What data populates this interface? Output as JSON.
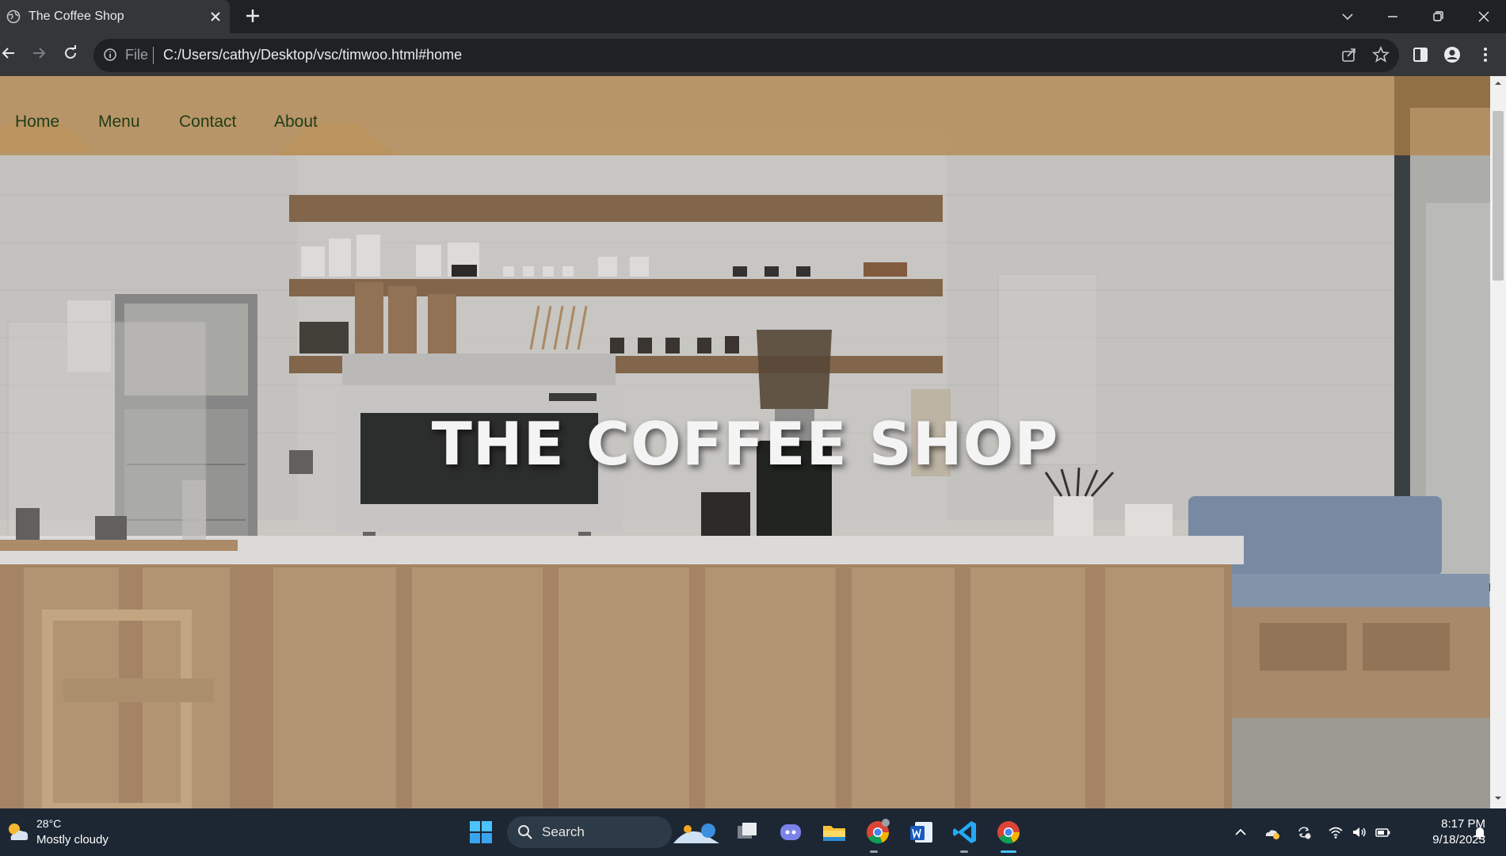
{
  "browser": {
    "tab_title": "The Coffee Shop",
    "omnibox": {
      "scheme_label": "File",
      "url": "C:/Users/cathy/Desktop/vsc/timwoo.html#home"
    }
  },
  "page": {
    "nav": [
      {
        "label": "Home"
      },
      {
        "label": "Menu"
      },
      {
        "label": "Contact"
      },
      {
        "label": "About"
      }
    ],
    "hero_title": "THE COFFEE SHOP",
    "colors": {
      "nav_bar": "#b48446",
      "nav_text": "#1f3d18",
      "hero_text": "#f4f4f4"
    }
  },
  "taskbar": {
    "weather": {
      "temp": "28°C",
      "condition": "Mostly cloudy"
    },
    "search_label": "Search",
    "clock": {
      "time": "8:17 PM",
      "date": "9/18/2023"
    },
    "apps": [
      "start-icon",
      "search-icon",
      "task-view-icon",
      "teams-chat-icon",
      "file-explorer-icon",
      "chrome-icon",
      "word-icon",
      "vscode-icon",
      "chrome-icon"
    ]
  }
}
